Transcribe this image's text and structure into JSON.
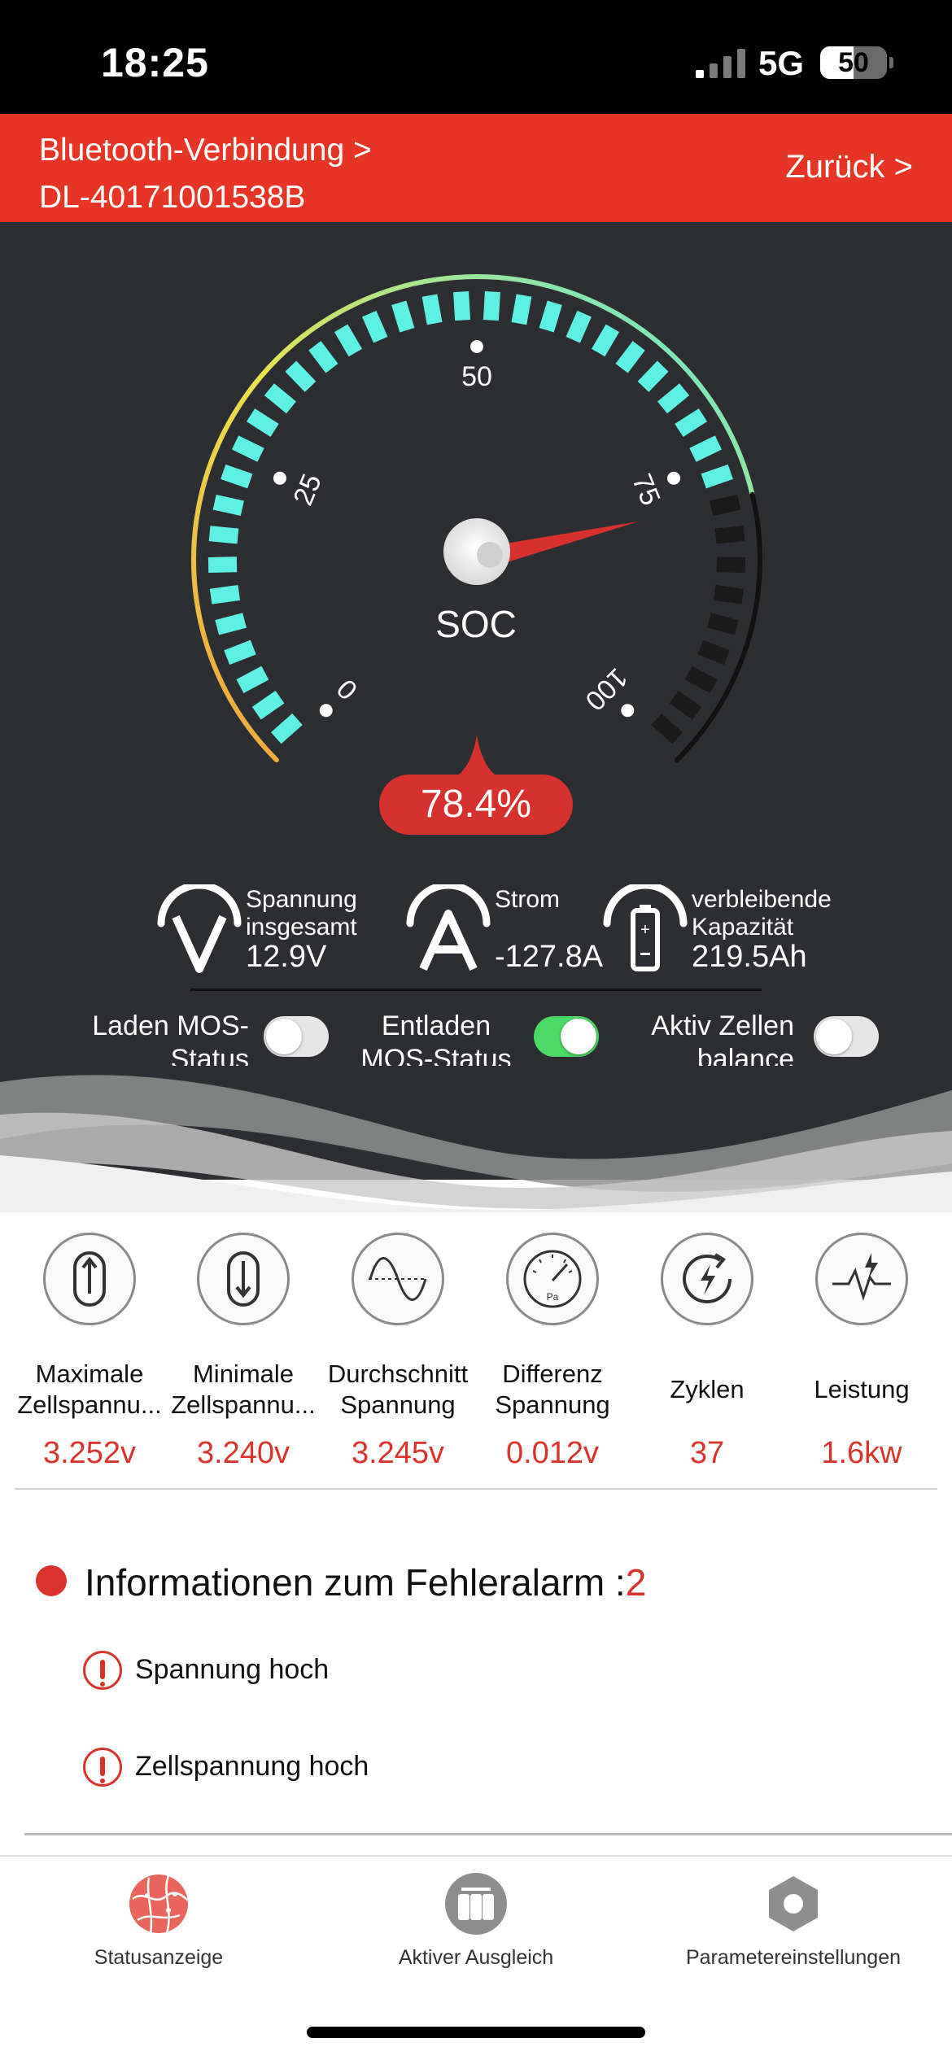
{
  "status_bar": {
    "time": "18:25",
    "network": "5G",
    "battery": "50",
    "battery_fraction": 0.5
  },
  "header": {
    "breadcrumb_line1": "Bluetooth-Verbindung >",
    "breadcrumb_line2": "DL-40171001538B",
    "back": "Zurück >"
  },
  "gauge": {
    "label": "SOC",
    "value_text": "78.4%",
    "value": 78.4,
    "ticks": [
      "0",
      "25",
      "50",
      "75",
      "100"
    ],
    "colors": {
      "active": "#5ef0e4",
      "inactive": "#1a1a1a",
      "needle": "#d6312c",
      "arc_low": "#f2a13a",
      "arc_mid": "#e9e34a",
      "arc_high": "#55e9df"
    }
  },
  "metrics": [
    {
      "label": "Spannung\ninsgesamt",
      "value": "12.9V",
      "icon": "voltage-icon"
    },
    {
      "label": "Strom",
      "value": "-127.8A",
      "icon": "current-icon"
    },
    {
      "label": "verbleibende\nKapazität",
      "value": "219.5Ah",
      "icon": "battery-capacity-icon"
    }
  ],
  "toggles": [
    {
      "label_line1": "Laden MOS-",
      "label_line2": "Status",
      "state": "off"
    },
    {
      "label_line1": "Entladen",
      "label_line2": "MOS-Status",
      "state": "on"
    },
    {
      "label_line1": "Aktiv Zellen",
      "label_line2": "balance",
      "state": "off"
    }
  ],
  "cells": [
    {
      "name": "Maximale Zellspannu...",
      "value": "3.252v",
      "icon": "max-cell-voltage-icon"
    },
    {
      "name": "Minimale Zellspannu...",
      "value": "3.240v",
      "icon": "min-cell-voltage-icon"
    },
    {
      "name": "Durchschnitt Spannung",
      "value": "3.245v",
      "icon": "sine-wave-icon"
    },
    {
      "name": "Differenz Spannung",
      "value": "0.012v",
      "icon": "pressure-gauge-icon"
    },
    {
      "name": "Zyklen",
      "value": "37",
      "icon": "cycle-icon"
    },
    {
      "name": "Leistung",
      "value": "1.6kw",
      "icon": "power-pulse-icon"
    }
  ],
  "alarm": {
    "title": "Informationen zum Fehleralarm :",
    "count": "2",
    "items": [
      "Spannung hoch",
      "Zellspannung hoch"
    ]
  },
  "tabs": [
    {
      "label": "Statusanzeige",
      "icon": "status-globe-icon",
      "active": true
    },
    {
      "label": "Aktiver Ausgleich",
      "icon": "balance-icon",
      "active": false
    },
    {
      "label": "Parametereinstellungen",
      "icon": "settings-hex-icon",
      "active": false
    }
  ]
}
